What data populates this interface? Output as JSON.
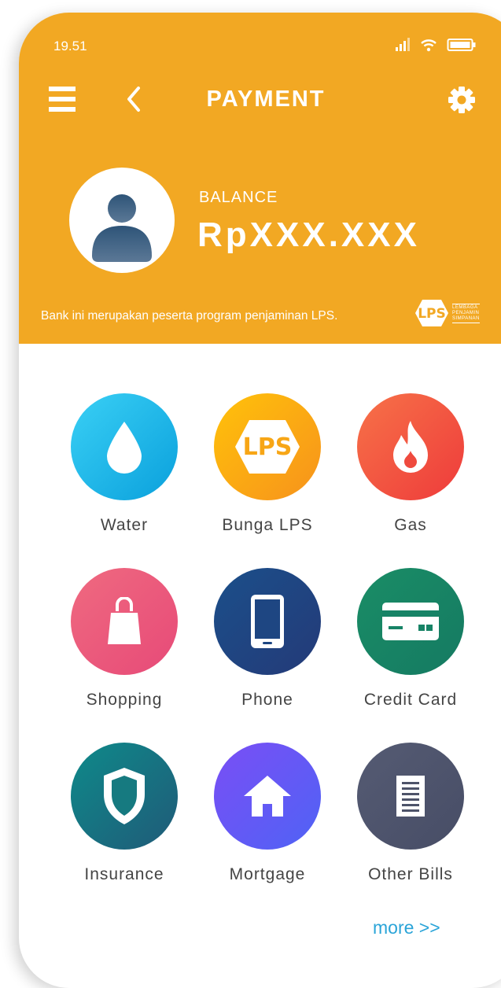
{
  "status_bar": {
    "time": "19.51",
    "icons": [
      "signal-icon",
      "wifi-icon",
      "battery-icon"
    ]
  },
  "header": {
    "title": "PAYMENT",
    "menu_icon": "hamburger-menu-icon",
    "back_icon": "back-arrow-icon",
    "settings_icon": "gear-icon",
    "background_color": "#f2a823"
  },
  "account": {
    "avatar_icon": "user-avatar-icon",
    "balance_label": "BALANCE",
    "balance_value": "RpXXX.XXX"
  },
  "lps": {
    "note": "Bank ini merupakan peserta program penjaminan LPS.",
    "logo_text": "LPS",
    "logo_lines": [
      "LEMBAGA",
      "PENJAMIN",
      "SIMPANAN"
    ]
  },
  "payment_options": [
    {
      "label": "Water",
      "icon": "water-drop-icon",
      "colors": [
        "#3ad0f5",
        "#0aa0dc"
      ]
    },
    {
      "label": "Bunga LPS",
      "icon": "lps-logo-icon",
      "colors": [
        "#ffc20a",
        "#f7921c"
      ]
    },
    {
      "label": "Gas",
      "icon": "flame-icon",
      "colors": [
        "#f77248",
        "#ee3b3b"
      ]
    },
    {
      "label": "Shopping",
      "icon": "shopping-bag-icon",
      "colors": [
        "#ef6a80",
        "#e74a78"
      ]
    },
    {
      "label": "Phone",
      "icon": "smartphone-icon",
      "colors": [
        "#1b4f8a",
        "#243a78"
      ]
    },
    {
      "label": "Credit Card",
      "icon": "credit-card-icon",
      "colors": [
        "#1a8d66",
        "#157a62"
      ]
    },
    {
      "label": "Insurance",
      "icon": "shield-icon",
      "colors": [
        "#0e8a8a",
        "#205a78"
      ]
    },
    {
      "label": "Mortgage",
      "icon": "house-icon",
      "colors": [
        "#7a4ef5",
        "#4f63f5"
      ]
    },
    {
      "label": "Other Bills",
      "icon": "bill-document-icon",
      "colors": [
        "#555b73",
        "#474d66"
      ]
    }
  ],
  "more_link": "more >>",
  "colors": {
    "accent": "#f2a823",
    "link": "#2aa4d8"
  }
}
